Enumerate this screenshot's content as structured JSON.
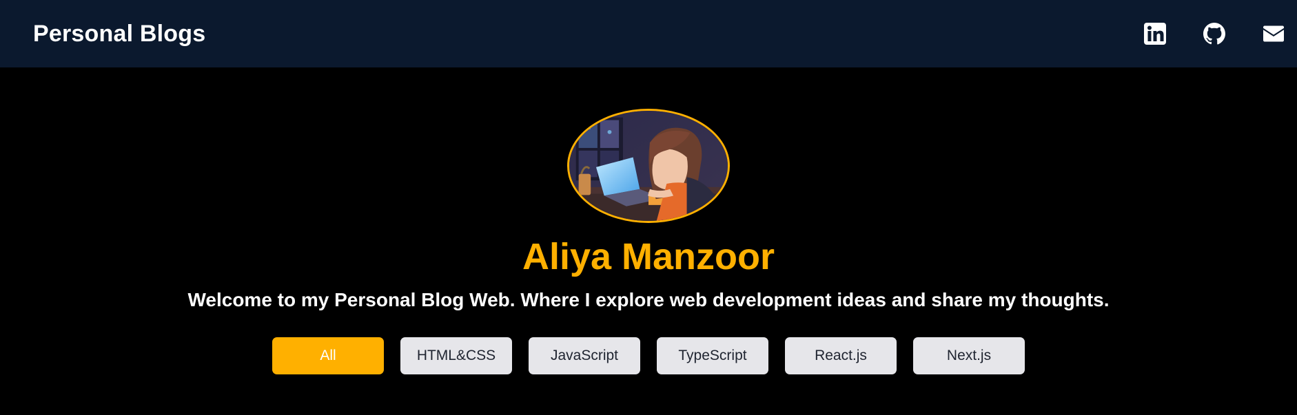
{
  "header": {
    "brand": "Personal Blogs",
    "socials": [
      {
        "icon": "linkedin-icon"
      },
      {
        "icon": "github-icon"
      },
      {
        "icon": "mail-icon"
      }
    ]
  },
  "profile": {
    "name": "Aliya Manzoor",
    "tagline": "Welcome to my Personal Blog Web. Where I explore web development ideas and share my thoughts."
  },
  "filters": {
    "active": "All",
    "items": [
      "All",
      "HTML&CSS",
      "JavaScript",
      "TypeScript",
      "React.js",
      "Next.js"
    ]
  },
  "colors": {
    "navbar": "#0b192e",
    "background": "#000000",
    "accent": "#ffb000",
    "chip": "#e6e6ea"
  }
}
